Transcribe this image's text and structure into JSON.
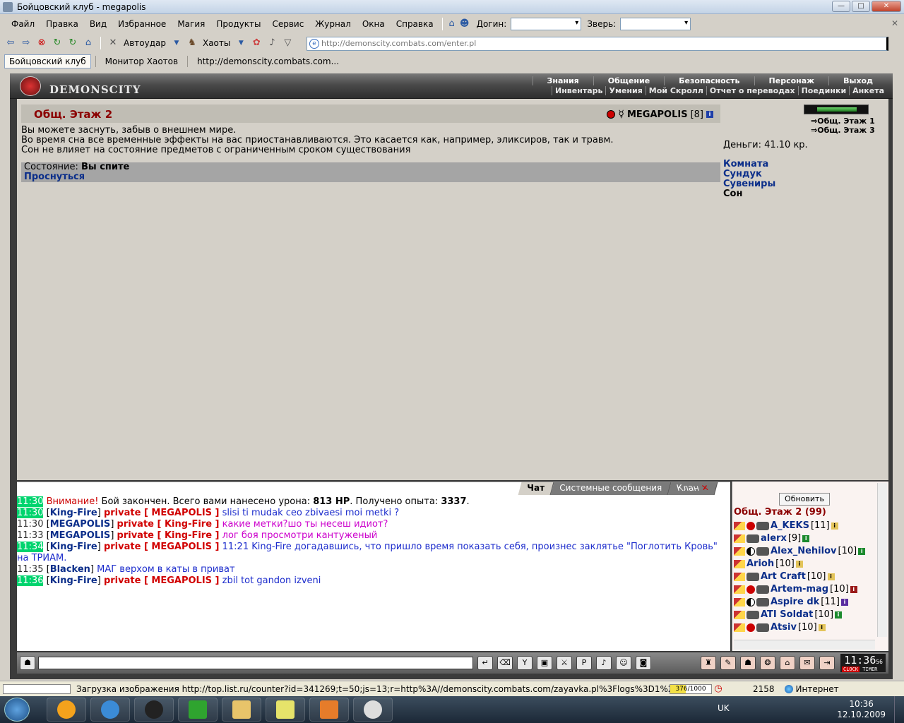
{
  "window": {
    "title": "Бойцовский клуб - megapolis",
    "buttons": {
      "minimize": "—",
      "maximize": "□",
      "close": "✕"
    }
  },
  "menu": {
    "items": [
      "Файл",
      "Правка",
      "Вид",
      "Избранное",
      "Магия",
      "Продукты",
      "Сервис",
      "Журнал",
      "Окна",
      "Справка"
    ],
    "login_label": "Догин:",
    "beast_label": "Зверь:",
    "login_value": "",
    "beast_value": ""
  },
  "toolbar": {
    "autohit_label": "Автоудар",
    "chaos_label": "Хаоты",
    "address": "http://demonscity.combats.com/enter.pl"
  },
  "tabs": [
    "Бойцовский клуб",
    "Монитор Хаотов",
    "http://demonscity.combats.com..."
  ],
  "game": {
    "logo_text": "DEMONSCITY",
    "header_menu_top": [
      "Знания",
      "Общение",
      "Безопасность",
      "Персонаж",
      "Выход"
    ],
    "header_menu_bottom": [
      "Инвентарь",
      "Умения",
      "Мой Скролл",
      "Отчет о переводах",
      "Поединки",
      "Анкета"
    ],
    "room": {
      "title": "Общ. Этаж 2",
      "player_name": "MEGAPOLIS",
      "player_level": "[8]",
      "text_lines": [
        "Вы можете заснуть, забыв о внешнем мире.",
        "Во время сна все временные эффекты на вас приостанавливаются. Это касается как, например, эликсиров, так и травм.",
        "Сон не влияет на состояние предметов с ограниченным сроком существования"
      ],
      "state_label": "Состояние:",
      "state_value": "Вы спите",
      "wake_link": "Проснуться"
    },
    "right_panel": {
      "hp_fill_fraction": 0.8,
      "floor_links": [
        "Общ. Этаж 1",
        "Общ. Этаж 3"
      ],
      "money": "Деньги: 41.10 кр.",
      "nav_links": [
        "Комната",
        "Сундук",
        "Сувениры"
      ],
      "nav_current": "Сон"
    },
    "chat": {
      "tabs": [
        "Чат",
        "Системные сообщения",
        "Клан"
      ],
      "lines": [
        {
          "time": "11:30",
          "hl": true,
          "parts": [
            [
              "warn",
              "Внимание!"
            ],
            [
              "",
              " Бой закончен. Всего вами нанесено урона: "
            ],
            [
              "b",
              "813 HP"
            ],
            [
              "",
              ". Получено опыта: "
            ],
            [
              "b",
              "3337"
            ],
            [
              "",
              "."
            ]
          ]
        },
        {
          "time": "11:30",
          "hl": true,
          "parts": [
            [
              "",
              "["
            ],
            [
              "nick",
              "King-Fire"
            ],
            [
              "",
              "] "
            ],
            [
              "priv",
              "private [ MEGAPOLIS ]"
            ],
            [
              "msg-blue",
              " slisi ti mudak ceo zbivaesi moi metki ?"
            ]
          ]
        },
        {
          "time": "11:30",
          "hl": false,
          "parts": [
            [
              "",
              "["
            ],
            [
              "nick",
              "MEGAPOLIS"
            ],
            [
              "",
              "] "
            ],
            [
              "priv",
              "private [ King-Fire ]"
            ],
            [
              "msg-pink",
              " какие метки?шо ты несеш идиот?"
            ]
          ]
        },
        {
          "time": "11:33",
          "hl": false,
          "parts": [
            [
              "",
              "["
            ],
            [
              "nick",
              "MEGAPOLIS"
            ],
            [
              "",
              "] "
            ],
            [
              "priv",
              "private [ King-Fire ]"
            ],
            [
              "msg-pink",
              " лог боя просмотри кантуженый"
            ]
          ]
        },
        {
          "time": "11:34",
          "hl": true,
          "parts": [
            [
              "",
              "["
            ],
            [
              "nick",
              "King-Fire"
            ],
            [
              "",
              "] "
            ],
            [
              "priv",
              "private [ MEGAPOLIS ]"
            ],
            [
              "msg-blue",
              " 11:21 King-Fire догадавшись, что пришло время показать себя, произнес заклятье \"Поглотить Кровь\" на ТРИАМ."
            ]
          ]
        },
        {
          "time": "11:35",
          "hl": false,
          "parts": [
            [
              "",
              "["
            ],
            [
              "nick",
              "Blacken"
            ],
            [
              "",
              "] "
            ],
            [
              "msg-blue",
              "МАГ верхом в каты в приват"
            ]
          ]
        },
        {
          "time": "11:36",
          "hl": true,
          "parts": [
            [
              "",
              "["
            ],
            [
              "nick",
              "King-Fire"
            ],
            [
              "",
              "] "
            ],
            [
              "priv",
              "private [ MEGAPOLIS ]"
            ],
            [
              "msg-blue",
              " zbil tot gandon izveni"
            ]
          ]
        }
      ]
    },
    "online": {
      "refresh_label": "Обновить",
      "title": "Общ. Этаж 2 (99)",
      "users": [
        {
          "name": "A_KEKS",
          "level": "[11]",
          "info": "i",
          "icons": [
            "arrow",
            "red",
            "clan"
          ]
        },
        {
          "name": "alerx",
          "level": "[9]",
          "info": "g",
          "icons": [
            "arrow",
            "clan"
          ]
        },
        {
          "name": "Alex_Nehilov",
          "level": "[10]",
          "info": "g",
          "icons": [
            "arrow",
            "yy",
            "clan"
          ]
        },
        {
          "name": "Arioh",
          "level": "[10]",
          "info": "i",
          "icons": [
            "arrow"
          ]
        },
        {
          "name": "Art Craft",
          "level": "[10]",
          "info": "i",
          "icons": [
            "arrow",
            "clan"
          ]
        },
        {
          "name": "Artem-mag",
          "level": "[10]",
          "info": "r",
          "icons": [
            "arrow",
            "red",
            "clan"
          ]
        },
        {
          "name": "Aspire dk",
          "level": "[11]",
          "info": "p",
          "icons": [
            "arrow",
            "yy",
            "clan"
          ]
        },
        {
          "name": "ATI Soldat",
          "level": "[10]",
          "info": "g",
          "icons": [
            "arrow",
            "clan"
          ]
        },
        {
          "name": "Atsiv",
          "level": "[10]",
          "info": "i",
          "icons": [
            "arrow",
            "red",
            "clan"
          ]
        }
      ]
    },
    "clock": {
      "time": "11:36",
      "seconds": "56",
      "label1": "CLOCK",
      "label2": "TIMER"
    }
  },
  "status": {
    "text": "Загрузка изображения http://top.list.ru/counter?id=341269;t=50;js=13;r=http%3A//demonscity.combats.com/zayavka.pl%3Flogs%3D1%260.91570196840356;j",
    "counter": "376/1000",
    "number": "2158",
    "zone": "Интернет"
  },
  "taskbar": {
    "lang": "UK",
    "time": "10:36",
    "date": "12.10.2009"
  },
  "colors": {
    "room_title": "#8b0000",
    "link": "#0b2e8a",
    "private": "#d10000",
    "time_highlight": "#00d46e"
  }
}
